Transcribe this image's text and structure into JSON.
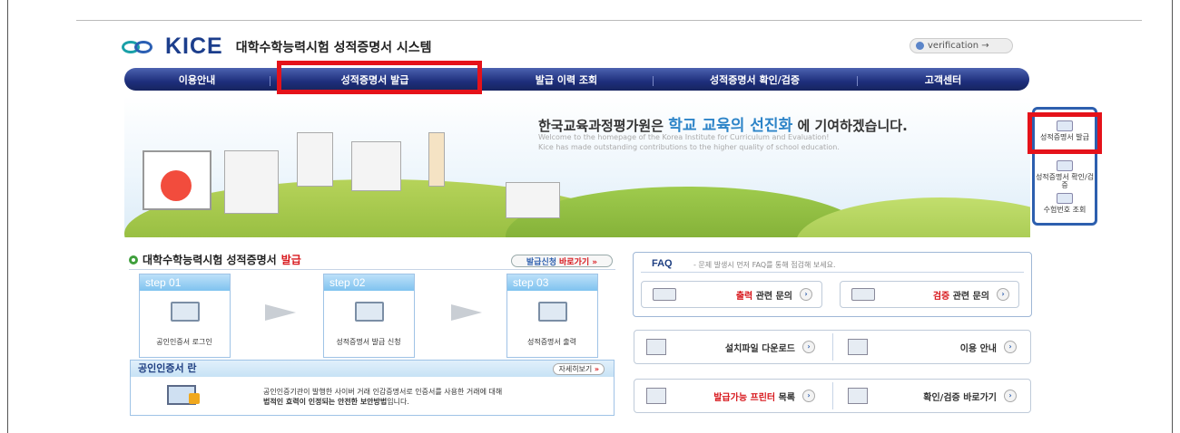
{
  "header": {
    "logo_text": "KICE",
    "system_title": "대학수학능력시험 성적증명서 시스템",
    "verification_label": "verification →"
  },
  "nav": {
    "items": [
      "이용안내",
      "성적증명서 발급",
      "발급 이력 조회",
      "성적증명서 확인/검증",
      "고객센터"
    ],
    "highlighted": "성적증명서 발급"
  },
  "banner": {
    "headline_pre": "한국교육과정평가원은",
    "headline_accent": "학교 교육의 선진화",
    "headline_post": "에 기여하겠습니다.",
    "sub_line_1": "Welcome to the homepage of the Korea Institute for Curriculum and Evaluation!",
    "sub_line_2": "Kice has made outstanding contributions to the higher quality of school education."
  },
  "quick_menu": {
    "items": [
      {
        "label": "성적증명서 발급"
      },
      {
        "label": "성적증명서 확인/검증"
      },
      {
        "label": "수험번호 조회"
      }
    ]
  },
  "issue_section": {
    "title_pre": "대학수학능력시험 성적증명서",
    "title_red": "발급",
    "apply_label": "발급신청",
    "apply_suffix": "바로가기 »",
    "steps": [
      {
        "step": "step 01",
        "label": "공인인증서 로그인"
      },
      {
        "step": "step 02",
        "label": "성적증명서 발급 신청"
      },
      {
        "step": "step 03",
        "label": "성적증명서 출력"
      }
    ],
    "cert": {
      "title": "공인인증서 란",
      "more_label": "자세히보기",
      "more_arrow": "»",
      "text_line_1": "공인인증기관이 발행한 사이버 거래 인감증명서로 인증서를 사용한 거래에 대해",
      "text_line_2_bold": "법적인 효력이 인정되는 안전한 보안방법",
      "text_line_2_rest": "입니다."
    }
  },
  "faq": {
    "title": "FAQ",
    "desc": "- 문제 발생시 먼저 FAQ를 통해 점검해 보세요.",
    "output_red": "출력",
    "output_rest": " 관련 문의",
    "verify_red": "검증",
    "verify_rest": " 관련 문의"
  },
  "links": {
    "install": "설치파일 다운로드",
    "usage": "이용 안내",
    "printer_red": "발급가능 프린터",
    "printer_rest": " 목록",
    "verify_go": "확인/검증 바로가기"
  },
  "go_glyph": "›",
  "colors": {
    "nav_dark": "#1e2f7c",
    "accent_red": "#e5121a",
    "quick_border": "#2d5fae"
  }
}
